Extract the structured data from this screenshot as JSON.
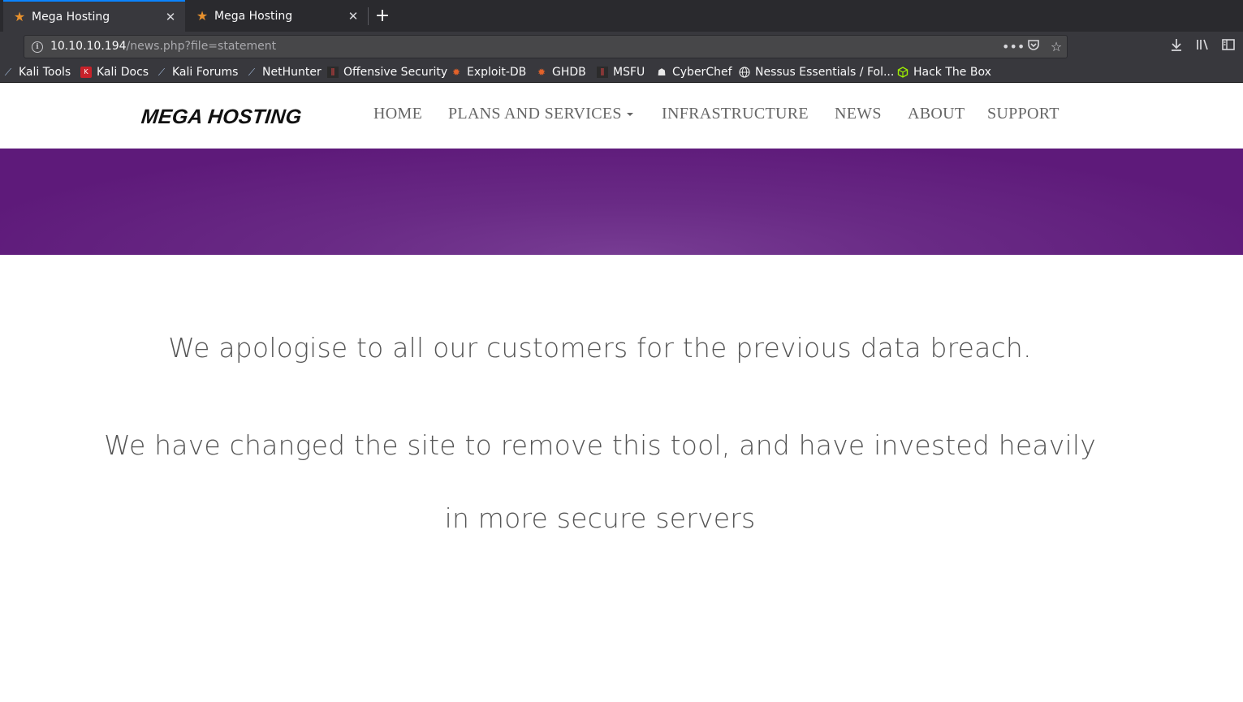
{
  "tabs": [
    {
      "title": "Mega Hosting",
      "favicon": "star-icon",
      "active": true
    },
    {
      "title": "Mega Hosting",
      "favicon": "star-icon",
      "active": false
    }
  ],
  "address": {
    "host": "10.10.10.194",
    "path": "/news.php?file=statement"
  },
  "bookmarks": [
    {
      "label": "Kali Tools",
      "icon": "kali-dragon-icon"
    },
    {
      "label": "Kali Docs",
      "icon": "kali-docs-icon"
    },
    {
      "label": "Kali Forums",
      "icon": "kali-dragon-icon"
    },
    {
      "label": "NetHunter",
      "icon": "kali-dragon-icon"
    },
    {
      "label": "Offensive Security",
      "icon": "offsec-icon"
    },
    {
      "label": "Exploit-DB",
      "icon": "exploit-db-icon"
    },
    {
      "label": "GHDB",
      "icon": "exploit-db-icon"
    },
    {
      "label": "MSFU",
      "icon": "offsec-icon"
    },
    {
      "label": "CyberChef",
      "icon": "chef-hat-icon"
    },
    {
      "label": "Nessus Essentials / Fol...",
      "icon": "globe-icon"
    },
    {
      "label": "Hack The Box",
      "icon": "htb-cube-icon"
    }
  ],
  "site": {
    "logo": "MEGA HOSTING",
    "nav": {
      "home": "HOME",
      "plans": "PLANS AND SERVICES",
      "infrastructure": "INFRASTRUCTURE",
      "news": "NEWS",
      "about": "ABOUT",
      "support": "SUPPORT"
    },
    "statement": {
      "line1": "We apologise to all our customers for the previous data breach.",
      "line2": "We have changed the site to remove this tool, and have invested heavily",
      "line3": "in more secure servers"
    }
  },
  "colors": {
    "accent_tab": "#0a84ff",
    "hero_purple": "#692a85",
    "text_gray": "#555555"
  }
}
